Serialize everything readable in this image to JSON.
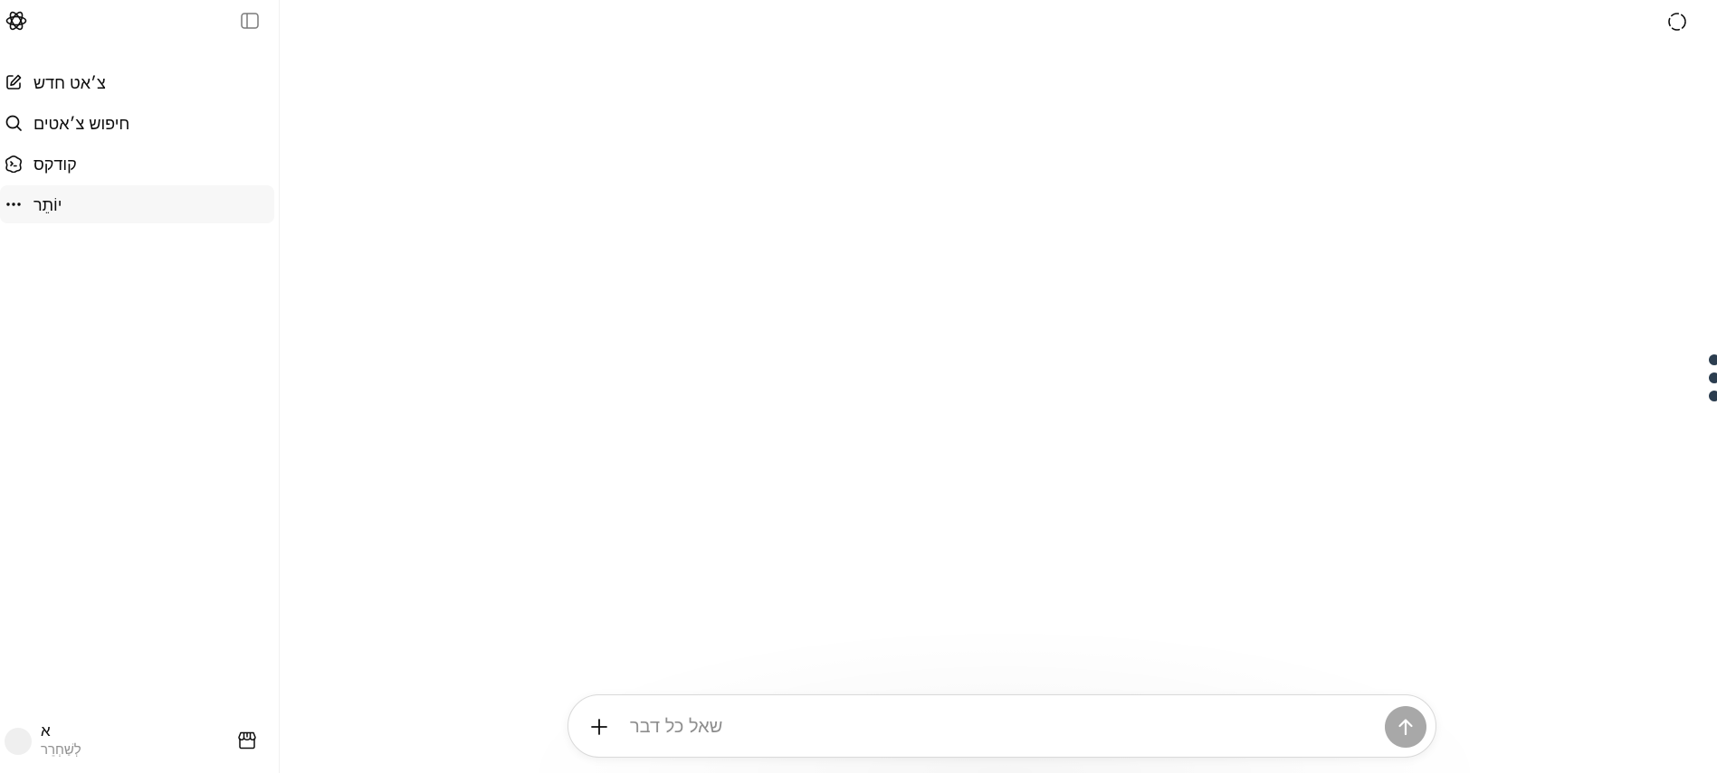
{
  "sidebar": {
    "logo_icon": "openai-logo-icon",
    "toggle_icon": "sidebar-toggle-icon",
    "items": [
      {
        "label": "צ׳אט חדש",
        "icon": "edit-icon"
      },
      {
        "label": "חיפוש צ׳אטים",
        "icon": "search-icon"
      },
      {
        "label": "קודקס",
        "icon": "codex-icon"
      },
      {
        "label": "יוֹתֵר",
        "icon": "more-horizontal-icon"
      }
    ],
    "active_index": 3,
    "user": {
      "name": "א",
      "subtitle": "לְשַׁחְרֵר",
      "store_icon": "store-icon"
    }
  },
  "header": {
    "corner_icon": "dashed-circle-icon"
  },
  "composer": {
    "placeholder": "שאל כל דבר",
    "value": "",
    "send_button_color": "#a8a8a8"
  },
  "colors": {
    "background": "#ffffff",
    "text": "#0d0d0d",
    "muted": "#8f8f8f",
    "dots": "#2c3e50"
  }
}
